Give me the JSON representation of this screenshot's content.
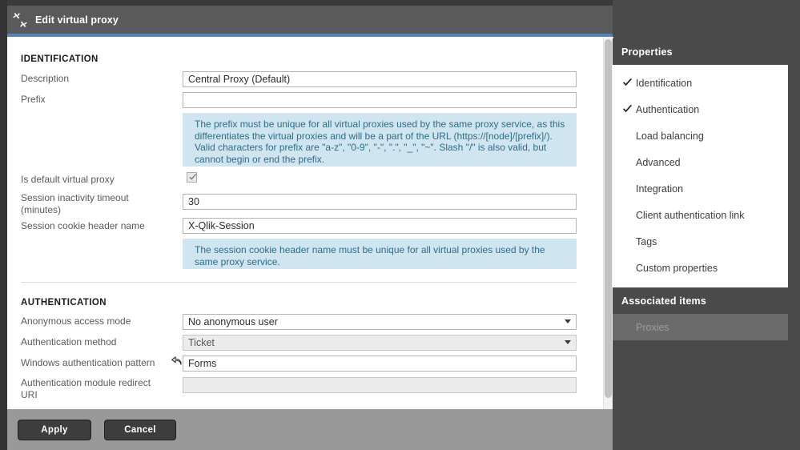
{
  "window": {
    "title": "Edit virtual proxy",
    "icon": "collapse-arrows-icon"
  },
  "form": {
    "sections": [
      {
        "id": "identification",
        "title": "IDENTIFICATION",
        "fields": {
          "description_label": "Description",
          "description_value": "Central Proxy (Default)",
          "prefix_label": "Prefix",
          "prefix_value": "",
          "prefix_help": "The prefix must be unique for all virtual proxies used by the same proxy service, as this differentiates the virtual proxies and will be a part of the URL (https://[node]/[prefix]/). Valid characters for prefix are \"a-z\", \"0-9\", \"-\", \".\", \"_\", \"~\". Slash \"/\" is also valid, but cannot begin or end the prefix.",
          "is_default_label": "Is default virtual proxy",
          "is_default_checked": true,
          "session_timeout_label": "Session inactivity timeout\n(minutes)",
          "session_timeout_value": "30",
          "cookie_header_label": "Session cookie header name",
          "cookie_header_value": "X-Qlik-Session",
          "cookie_header_help": "The session cookie header name must be unique for all virtual proxies used by the same proxy service."
        }
      },
      {
        "id": "authentication",
        "title": "AUTHENTICATION",
        "fields": {
          "anonymous_label": "Anonymous access mode",
          "anonymous_value": "No anonymous user",
          "method_label": "Authentication method",
          "method_value": "Ticket",
          "windows_pattern_label": "Windows authentication pattern",
          "windows_pattern_value": "Forms",
          "windows_pattern_reset_icon": "undo-arrow-icon",
          "redirect_uri_label": "Authentication module redirect\nURI",
          "redirect_uri_value": ""
        }
      }
    ]
  },
  "footer": {
    "apply_label": "Apply",
    "cancel_label": "Cancel"
  },
  "sidebar": {
    "properties_heading": "Properties",
    "properties_items": [
      {
        "label": "Identification",
        "checked": true
      },
      {
        "label": "Authentication",
        "checked": true
      },
      {
        "label": "Load balancing",
        "checked": false
      },
      {
        "label": "Advanced",
        "checked": false
      },
      {
        "label": "Integration",
        "checked": false
      },
      {
        "label": "Client authentication link",
        "checked": false
      },
      {
        "label": "Tags",
        "checked": false
      },
      {
        "label": "Custom properties",
        "checked": false
      }
    ],
    "associated_heading": "Associated items",
    "associated_items": [
      {
        "label": "Proxies"
      }
    ]
  },
  "colors": {
    "accent_blue": "#5584b8",
    "titlebar_gray": "#5a5a5a",
    "help_bg": "#cfe5ef",
    "help_text": "#2e6d86",
    "footer_gray": "#999999",
    "sidebar_gray": "#4a4a4a"
  }
}
